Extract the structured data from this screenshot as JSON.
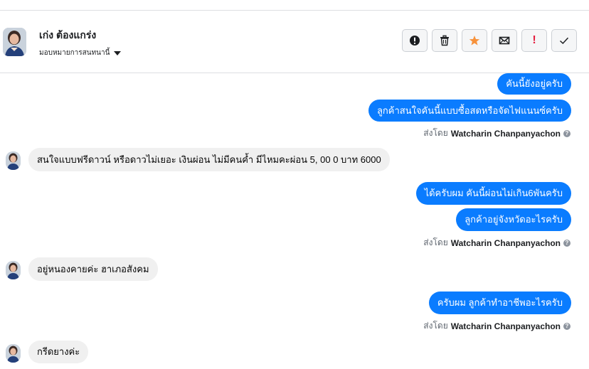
{
  "header": {
    "contact_name": "เก่ง ต้องแกร่ง",
    "assign_label": "มอบหมายการสนทนานี้",
    "actions": [
      {
        "name": "mark-spam-button",
        "icon": "alert-circle-icon"
      },
      {
        "name": "delete-button",
        "icon": "trash-icon"
      },
      {
        "name": "star-button",
        "icon": "star-icon",
        "color": "#f7923b"
      },
      {
        "name": "mark-unread-button",
        "icon": "envelope-icon"
      },
      {
        "name": "follow-up-button",
        "icon": "exclamation-icon",
        "color": "#e41e3f"
      },
      {
        "name": "mark-done-button",
        "icon": "checkmark-icon"
      }
    ]
  },
  "messages": [
    {
      "dir": "out",
      "text": "คันนี้ยังอยู่ครับ"
    },
    {
      "dir": "out",
      "text": "ลูกค้าสนใจคันนี้แบบซื้อสดหรือจัดไฟแนนซ์ครับ"
    },
    {
      "dir": "meta",
      "prefix": "ส่งโดย",
      "sender": "Watcharin Chanpanyachon"
    },
    {
      "dir": "in",
      "text": "สนใจแบบฟรีดาวน์ หรือดาวไม่เยอะ เงินผ่อน ไม่มีคนค้ำ มีไหมคะผ่อน 5, 00 0 บาท 6000"
    },
    {
      "dir": "out",
      "text": "ได้ครับผม คันนี้ผ่อนไม่เกิน6พันครับ"
    },
    {
      "dir": "out",
      "text": "ลูกค้าอยู่จังหวัดอะไรครับ"
    },
    {
      "dir": "meta",
      "prefix": "ส่งโดย",
      "sender": "Watcharin Chanpanyachon"
    },
    {
      "dir": "in",
      "text": "อยู่หนองคายค่ะ ฮาเภอสังคม"
    },
    {
      "dir": "out",
      "text": "ครับผม ลูกค้าทำอาชีพอะไรครับ"
    },
    {
      "dir": "meta",
      "prefix": "ส่งโดย",
      "sender": "Watcharin Chanpanyachon"
    },
    {
      "dir": "in",
      "text": "กรีดยางค่ะ"
    }
  ],
  "colors": {
    "outgoing": "#0a7cff",
    "incoming": "#f0f0f0",
    "star": "#f7923b",
    "alert": "#e41e3f"
  }
}
